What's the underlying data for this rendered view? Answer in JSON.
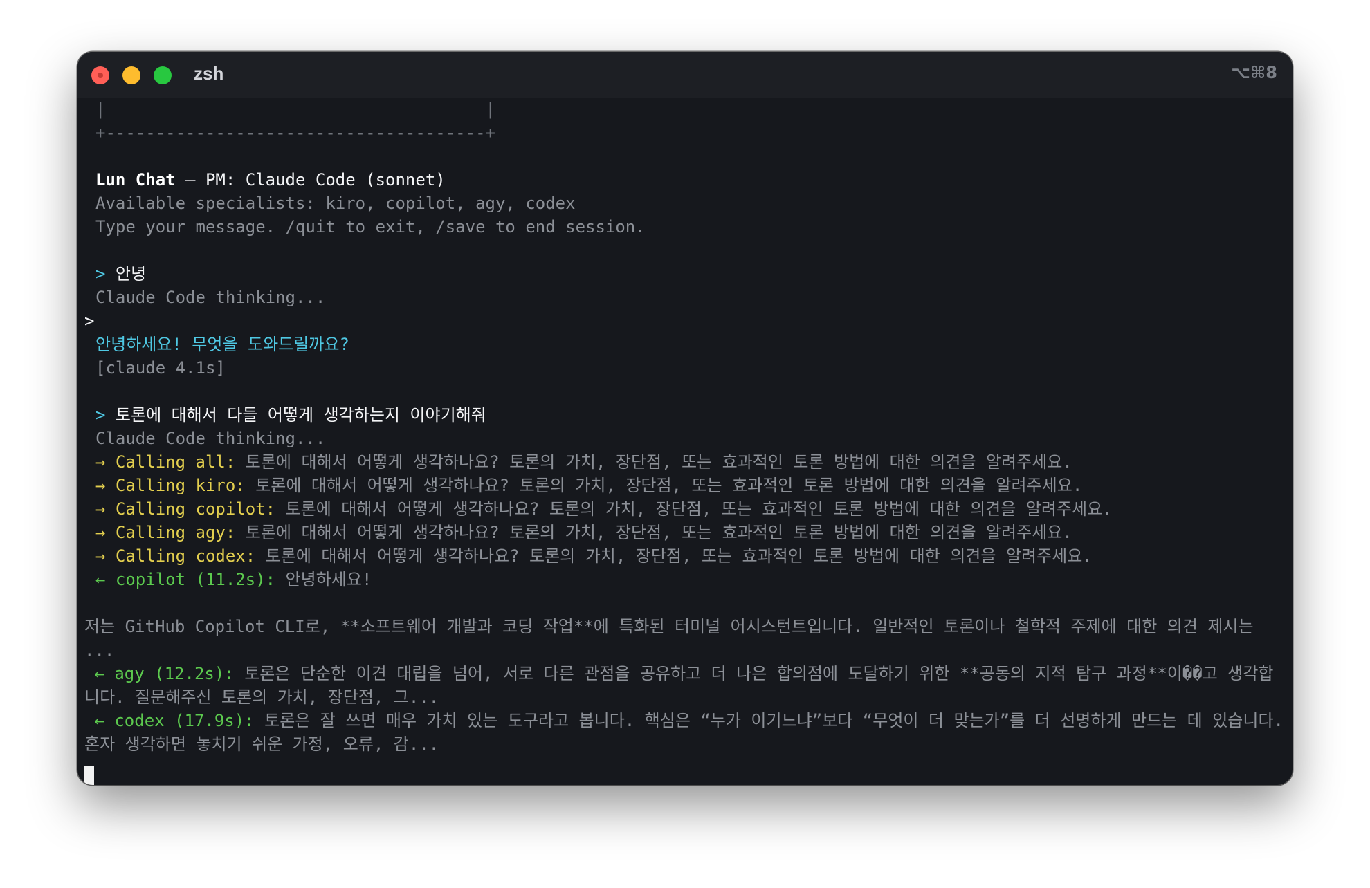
{
  "window": {
    "title": "zsh",
    "shortcut": "⌥⌘8"
  },
  "terminal": {
    "box_side_line": "|                                      |",
    "box_bottom_line": "+--------------------------------------+",
    "header": {
      "app_name": "Lun Chat",
      "pm_info": " – PM: Claude Code (sonnet)"
    },
    "specialists_line": "Available specialists: kiro, copilot, agy, codex",
    "instructions_line": "Type your message. /quit to exit, /save to end session.",
    "prompt_symbol": ">",
    "turns": [
      {
        "user_message": "안녕",
        "thinking": "Claude Code thinking...",
        "stray_prompt": ">",
        "reply": "안녕하세요! 무엇을 도와드릴까요?",
        "timing": "[claude 4.1s]"
      },
      {
        "user_message": "토론에 대해서 다들 어떻게 생각하는지 이야기해줘",
        "thinking": "Claude Code thinking...",
        "calls": [
          {
            "arrow": "→",
            "label": "Calling all:",
            "text": "토론에 대해서 어떻게 생각하나요? 토론의 가치, 장단점, 또는 효과적인 토론 방법에 대한 의견을 알려주세요."
          },
          {
            "arrow": "→",
            "label": "Calling kiro:",
            "text": "토론에 대해서 어떻게 생각하나요? 토론의 가치, 장단점, 또는 효과적인 토론 방법에 대한 의견을 알려주세요."
          },
          {
            "arrow": "→",
            "label": "Calling copilot:",
            "text": "토론에 대해서 어떻게 생각하나요? 토론의 가치, 장단점, 또는 효과적인 토론 방법에 대한 의견을 알려주세요."
          },
          {
            "arrow": "→",
            "label": "Calling agy:",
            "text": "토론에 대해서 어떻게 생각하나요? 토론의 가치, 장단점, 또는 효과적인 토론 방법에 대한 의견을 알려주세요."
          },
          {
            "arrow": "→",
            "label": "Calling codex:",
            "text": "토론에 대해서 어떻게 생각하나요? 토론의 가치, 장단점, 또는 효과적인 토론 방법에 대한 의견을 알려주세요."
          }
        ],
        "responses": [
          {
            "arrow": "←",
            "label": "copilot (11.2s):",
            "first_line": "안녕하세요!",
            "continuation": "저는 GitHub Copilot CLI로, **소프트웨어 개발과 코딩 작업**에 특화된 터미널 어시스턴트입니다. 일반적인 토론이나 철학적 주제에 대한 의견 제시는 ..."
          },
          {
            "arrow": "←",
            "label": "agy (12.2s):",
            "text": "토론은 단순한 이견 대립을 넘어, 서로 다른 관점을 공유하고 더 나은 합의점에 도달하기 위한 **공동의 지적 탐구 과정**이��고 생각합니다. 질문해주신 토론의 가치, 장단점, 그..."
          },
          {
            "arrow": "←",
            "label": "codex (17.9s):",
            "text": "토론은 잘 쓰면 매우 가치 있는 도구라고 봅니다. 핵심은 “누가 이기느냐”보다 “무엇이 더 맞는가”를 더 선명하게 만드는 데 있습니다. 혼자 생각하면 놓치기 쉬운 가정, 오류, 감..."
          }
        ]
      }
    ]
  },
  "colors": {
    "background": "#16181d",
    "titlebar": "#1d1f24",
    "prompt_cyan": "#4fc8e3",
    "call_yellow": "#e3cf4f",
    "response_green": "#5cc94e",
    "dim_gray": "#8c9097"
  }
}
